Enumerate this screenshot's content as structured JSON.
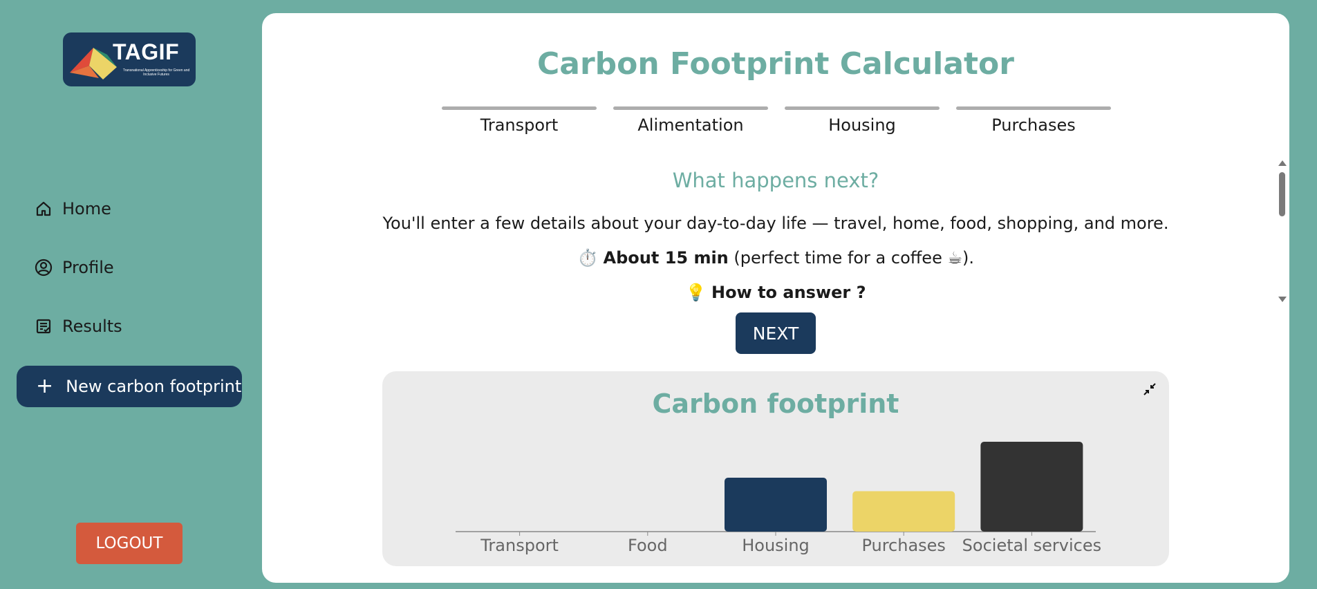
{
  "sidebar": {
    "logo": {
      "word": "TAGIF",
      "subtitle": "Transnational Apprenticeship for Green and Inclusive Futures"
    },
    "nav": [
      {
        "label": "Home",
        "icon": "home-icon"
      },
      {
        "label": "Profile",
        "icon": "user-circle-icon"
      },
      {
        "label": "Results",
        "icon": "results-icon"
      }
    ],
    "new_button": "New carbon footprint",
    "logout": "LOGOUT"
  },
  "main": {
    "title": "Carbon Footprint Calculator",
    "steps": [
      "Transport",
      "Alimentation",
      "Housing",
      "Purchases"
    ],
    "subheading": "What happens next?",
    "intro": "You'll enter a few details about your day-to-day life — travel, home, food, shopping, and more.",
    "time_bold": "About 15 min",
    "time_rest": " (perfect time for a coffee ",
    "time_end": ").",
    "how_to": "How to answer ?",
    "next_button": "NEXT"
  },
  "colors": {
    "accent": "#6dada2",
    "navy": "#1b3a5c",
    "logout": "#d45a3d",
    "yellow": "#ecd467",
    "dark": "#333333"
  },
  "chart_data": {
    "type": "bar",
    "title": "Carbon footprint",
    "categories": [
      "Transport",
      "Food",
      "Housing",
      "Purchases",
      "Societal services"
    ],
    "values": [
      0,
      0,
      0.6,
      0.45,
      1.0
    ],
    "colors": [
      "#1b3a5c",
      "#1b3a5c",
      "#1b3a5c",
      "#ecd467",
      "#333333"
    ],
    "grid": false
  }
}
